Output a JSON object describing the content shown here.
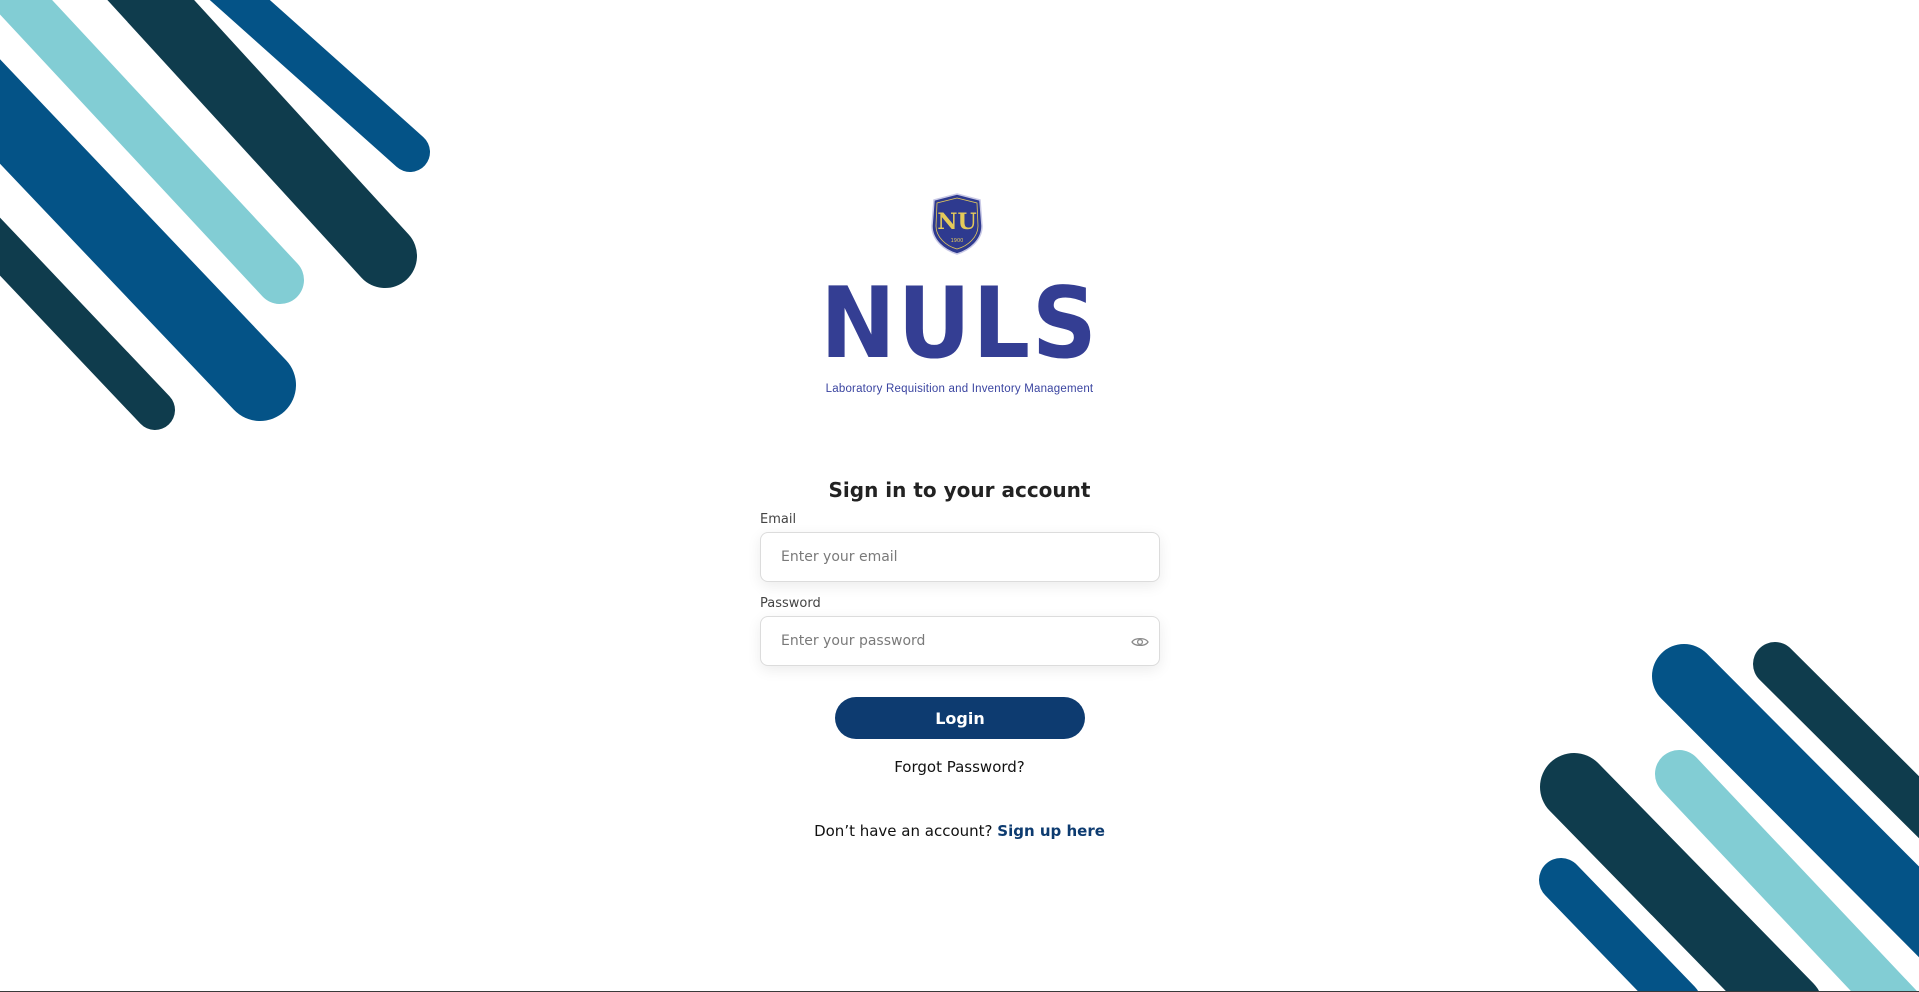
{
  "brand": {
    "title": "NULS",
    "subtitle": "Laboratory Requisition and Inventory Management",
    "seal_text": "NU",
    "seal_year": "1900",
    "logo_icon": "university-seal-icon"
  },
  "form": {
    "heading": "Sign in to your account",
    "email": {
      "label": "Email",
      "placeholder": "Enter your email",
      "value": ""
    },
    "password": {
      "label": "Password",
      "placeholder": "Enter your password",
      "value": "",
      "toggle_icon": "eye-icon"
    },
    "login_label": "Login",
    "forgot_label": "Forgot Password?",
    "signup_prompt": "Don’t have an account?",
    "signup_link": "Sign up here"
  },
  "colors": {
    "brand_navy": "#343e93",
    "button": "#0d3b70",
    "stripe_dark": "#0f3c4d",
    "stripe_blue": "#045387",
    "stripe_light": "#82cdd4"
  }
}
